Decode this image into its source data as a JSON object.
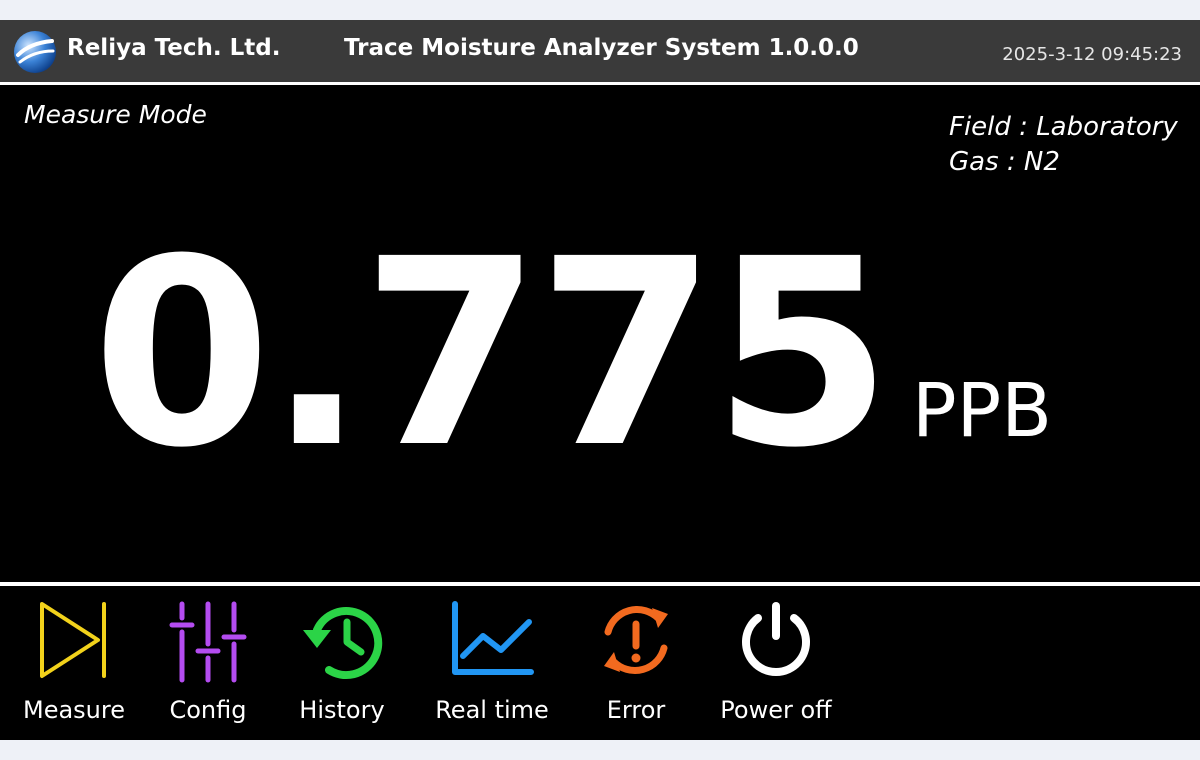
{
  "header": {
    "brand": "Reliya Tech. Ltd.",
    "title": "Trace Moisture Analyzer System 1.0.0.0",
    "datetime": "2025-3-12  09:45:23"
  },
  "main": {
    "mode": "Measure Mode",
    "field": "Field : Laboratory",
    "gas": "Gas : N2",
    "reading": "0.775",
    "unit": "PPB"
  },
  "toolbar": {
    "measure": {
      "label": "Measure",
      "icon": "play-skip-icon",
      "color": "#f2d21b"
    },
    "config": {
      "label": "Config",
      "icon": "sliders-icon",
      "color": "#b44cf0"
    },
    "history": {
      "label": "History",
      "icon": "history-clock-icon",
      "color": "#2bd447"
    },
    "realtime": {
      "label": "Real time",
      "icon": "line-chart-icon",
      "color": "#2196f3"
    },
    "error": {
      "label": "Error",
      "icon": "error-sync-icon",
      "color": "#f26a1f"
    },
    "poweroff": {
      "label": "Power off",
      "icon": "power-icon",
      "color": "#ffffff"
    }
  }
}
